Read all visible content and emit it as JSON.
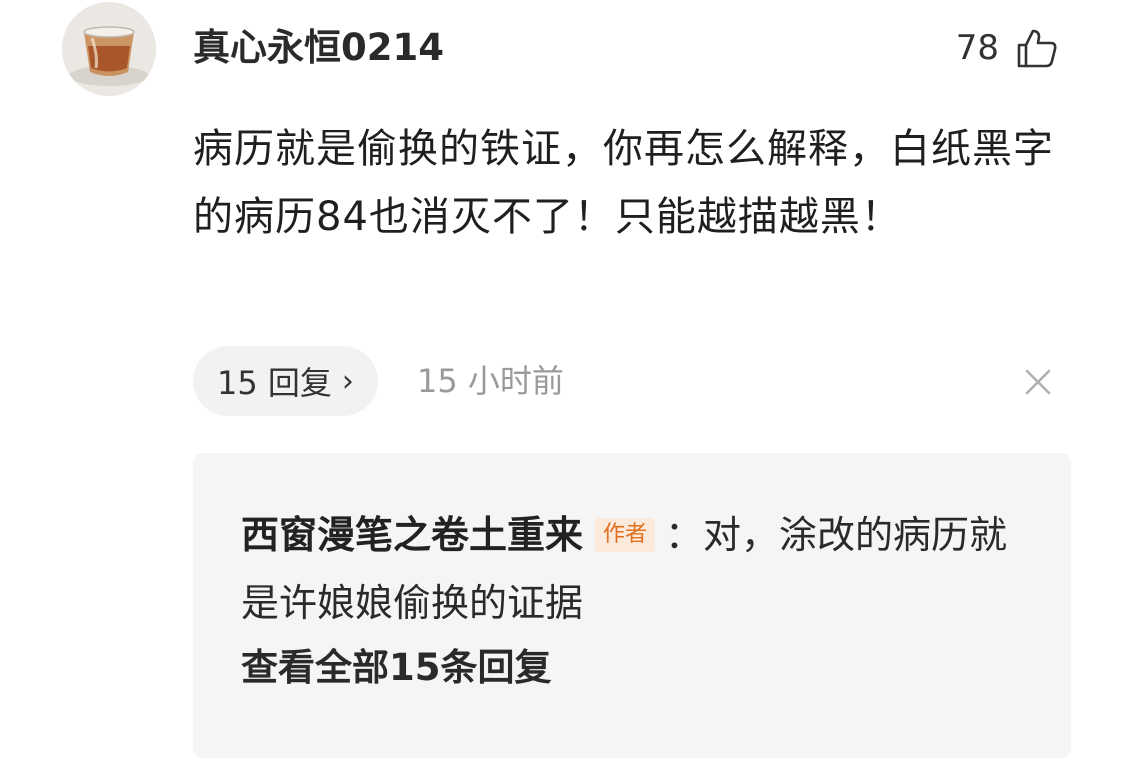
{
  "comment": {
    "username": "真心永恒0214",
    "like_count": "78",
    "text": "病历就是偷换的铁证，你再怎么解释，白纸黑字的病历84也消灭不了！只能越描越黑！",
    "reply_count_label": "15 回复",
    "timestamp": "15 小时前"
  },
  "reply_preview": {
    "author": "西窗漫笔之卷土重来",
    "author_tag": "作者",
    "text": "：对，涂改的病历就是许娘娘偷换的证据",
    "view_all_label": "查看全部15条回复"
  },
  "icons": {
    "avatar": "avatar-tea-cup",
    "like": "thumbs-up-icon",
    "reply_chevron": "chevron-right-icon",
    "close": "close-icon"
  },
  "colors": {
    "author_tag_text": "#e0701e",
    "author_tag_bg": "#fbe9dc",
    "timestamp": "#9a9a9a",
    "reply_box_bg": "#f5f5f5"
  }
}
